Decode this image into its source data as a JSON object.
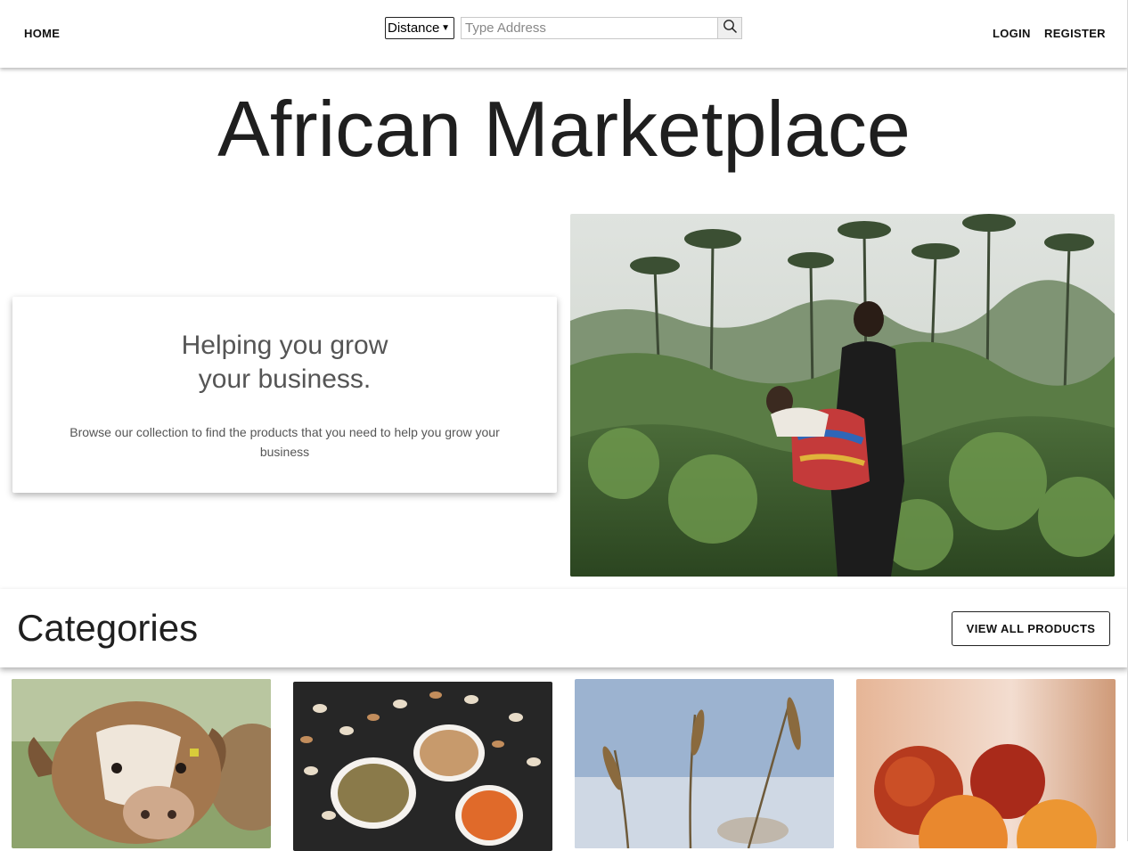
{
  "header": {
    "home_label": "HOME",
    "login_label": "LOGIN",
    "register_label": "REGISTER",
    "distance_select": "Distance",
    "address_placeholder": "Type Address",
    "search_icon": "search-icon"
  },
  "hero": {
    "title": "African Marketplace",
    "card_heading_line1": "Helping you grow",
    "card_heading_line2": "your business.",
    "card_text": "Browse our collection to find the products that you need to help you grow your business",
    "photo_icon": "woman-carrying-baby-photo"
  },
  "categories": {
    "title": "Categories",
    "view_all_label": "VIEW ALL PRODUCTS",
    "cards": [
      {
        "image": "cow-photo"
      },
      {
        "image": "beans-lentils-photo"
      },
      {
        "image": "wheat-photo"
      },
      {
        "image": "peaches-photo"
      }
    ]
  },
  "colors": {
    "text": "#1f1f1f",
    "muted": "#555555",
    "border": "#222222"
  }
}
